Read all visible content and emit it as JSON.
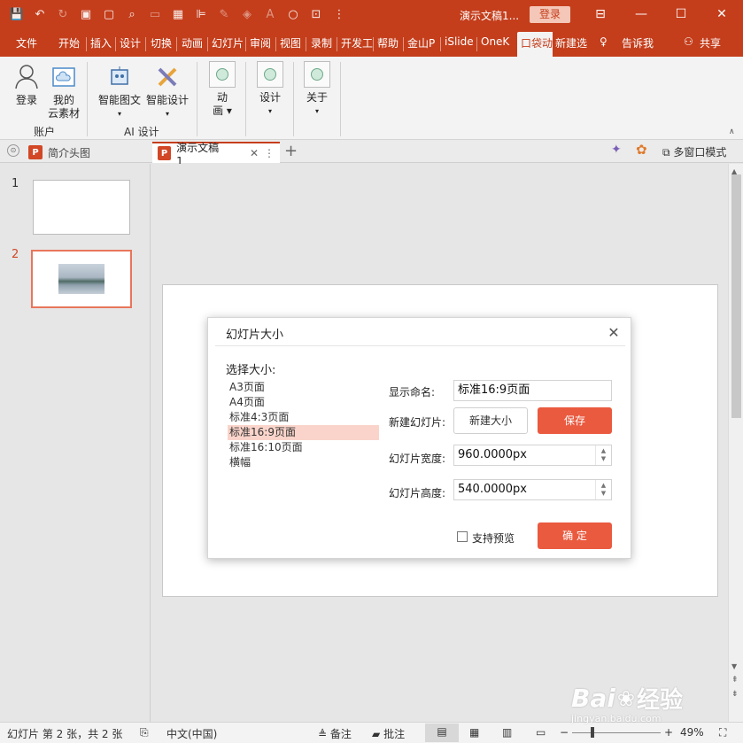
{
  "titlebar": {
    "doc_title": "演示文稿1...",
    "login_label": "登录"
  },
  "tabs": [
    "文件",
    "开始",
    "插入",
    "设计",
    "切换",
    "动画",
    "幻灯片",
    "审阅",
    "视图",
    "录制",
    "开发工",
    "帮助",
    "金山P",
    "iSlide",
    "OneK",
    "口袋动",
    "新建选",
    "告诉我",
    "共享"
  ],
  "ribbon": {
    "login": "登录",
    "cloud_line1": "我的",
    "cloud_line2": "云素材",
    "group_account": "账户",
    "smart_graphic": "智能图文",
    "smart_design": "智能设计",
    "group_ai": "AI 设计",
    "anim_line1": "动",
    "anim_line2": "画",
    "design": "设计",
    "about": "关于"
  },
  "doctabs": {
    "tab1": "简介头图",
    "tab2": "演示文稿1",
    "multiwin": "多窗口模式"
  },
  "thumbnails": {
    "num1": "1",
    "num2": "2"
  },
  "dialog": {
    "title": "幻灯片大小",
    "select_label": "选择大小:",
    "options": [
      "A3页面",
      "A4页面",
      "标准4:3页面",
      "标准16:9页面",
      "标准16:10页面",
      "横幅"
    ],
    "display_name_label": "显示命名:",
    "display_name_value": "标准16:9页面",
    "new_slide_label": "新建幻灯片:",
    "new_size_button": "新建大小",
    "save_button": "保存",
    "width_label": "幻灯片宽度:",
    "width_value": "960.0000px",
    "height_label": "幻灯片高度:",
    "height_value": "540.0000px",
    "preview_label": "支持预览",
    "ok_button": "确 定"
  },
  "status": {
    "slide_info": "幻灯片 第 2 张，共 2 张",
    "language": "中文(中国)",
    "notes": "备注",
    "comments": "批注",
    "zoom": "49%"
  },
  "watermark": {
    "brand": "Bai",
    "brand2": "经验",
    "url": "jingyan.baidu.com"
  },
  "colors": {
    "accent": "#c43e1c",
    "button_red": "#ea5a3f",
    "selection": "#fad4ca"
  }
}
